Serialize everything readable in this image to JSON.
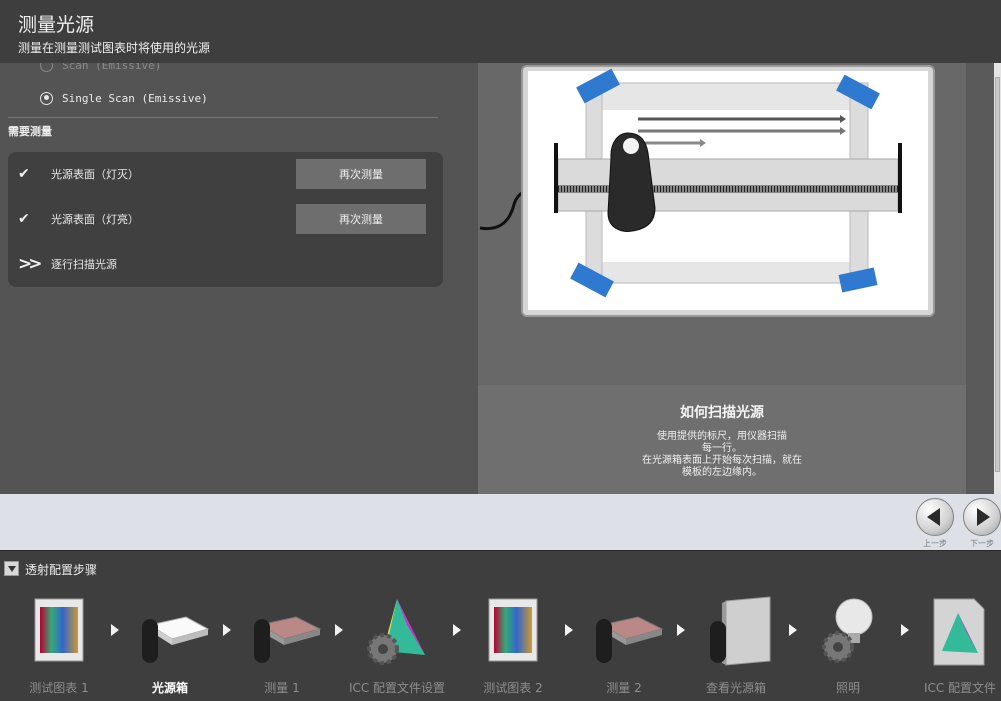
{
  "header": {
    "title": "测量光源",
    "subtitle": "测量在测量测试图表时将使用的光源"
  },
  "options": {
    "partial_option_label": "Scan (Emissive)",
    "single_scan_label": "Single Scan (Emissive)"
  },
  "measurements": {
    "section_title": "需要测量",
    "rows": [
      {
        "status": "done",
        "label": "光源表面（灯灭）",
        "button": "再次测量"
      },
      {
        "status": "done",
        "label": "光源表面（灯亮）",
        "button": "再次测量"
      },
      {
        "status": "current",
        "label": "逐行扫描光源"
      }
    ]
  },
  "howto": {
    "title": "如何扫描光源",
    "text": "使用提供的标尺，用仪器扫描\n每一行。\n在光源箱表面上开始每次扫描，就在\n模板的左边缘内。"
  },
  "nav": {
    "back_label": "上一步",
    "next_label": "下一步"
  },
  "steps": {
    "title": "透射配置步骤",
    "items": [
      {
        "label": "测试图表 1",
        "icon": "test-chart-icon",
        "active": false
      },
      {
        "label": "光源箱",
        "icon": "light-box-icon",
        "active": true
      },
      {
        "label": "测量 1",
        "icon": "measure-device-icon",
        "active": false
      },
      {
        "label": "ICC 配置文件设置",
        "icon": "icc-gear-icon",
        "active": false
      },
      {
        "label": "测试图表 2",
        "icon": "test-chart-icon",
        "active": false
      },
      {
        "label": "测量 2",
        "icon": "measure-device-icon",
        "active": false
      },
      {
        "label": "查看光源箱",
        "icon": "view-light-box-icon",
        "active": false
      },
      {
        "label": "照明",
        "icon": "bulb-gear-icon",
        "active": false
      },
      {
        "label": "ICC 配置文件",
        "icon": "icc-profile-icon",
        "active": false
      }
    ]
  },
  "colors": {
    "tape": "#2f7ad0",
    "panel_dark": "#404040",
    "button": "#6e6e6e"
  }
}
